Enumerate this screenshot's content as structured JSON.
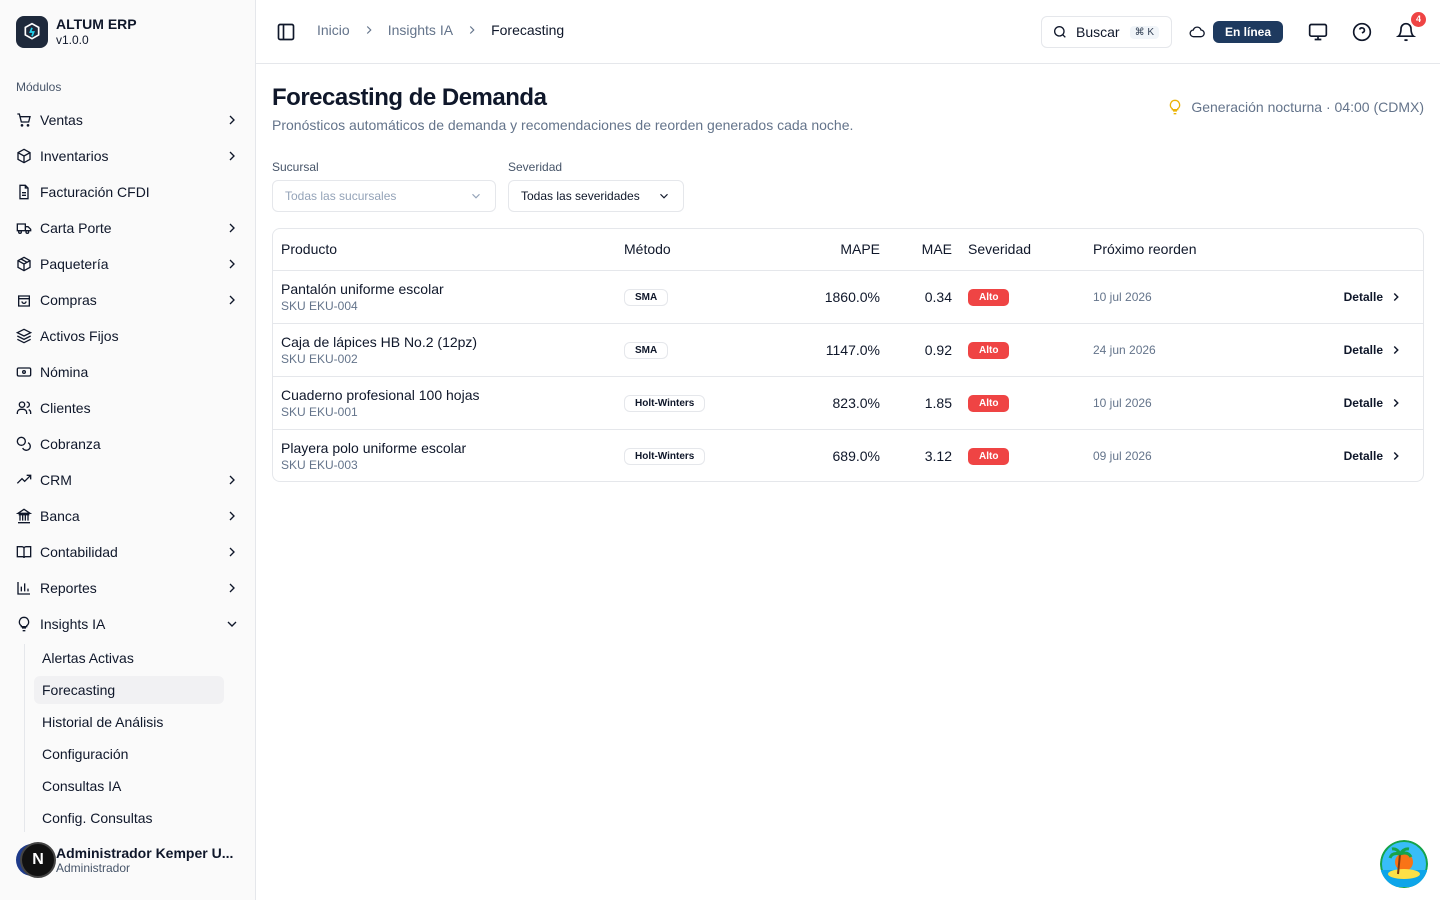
{
  "app": {
    "name": "ALTUM ERP",
    "version": "v1.0.0"
  },
  "sidebar": {
    "section_label": "Módulos",
    "items": [
      {
        "label": "Ventas",
        "icon": "cart-icon",
        "has_children": true
      },
      {
        "label": "Inventarios",
        "icon": "box-icon",
        "has_children": true
      },
      {
        "label": "Facturación CFDI",
        "icon": "file-text-icon",
        "has_children": false
      },
      {
        "label": "Carta Porte",
        "icon": "truck-icon",
        "has_children": true
      },
      {
        "label": "Paquetería",
        "icon": "package-icon",
        "has_children": true
      },
      {
        "label": "Compras",
        "icon": "shopping-bag-icon",
        "has_children": true
      },
      {
        "label": "Activos Fijos",
        "icon": "layers-icon",
        "has_children": false
      },
      {
        "label": "Nómina",
        "icon": "banknote-icon",
        "has_children": false
      },
      {
        "label": "Clientes",
        "icon": "users-icon",
        "has_children": false
      },
      {
        "label": "Cobranza",
        "icon": "coins-icon",
        "has_children": false
      },
      {
        "label": "CRM",
        "icon": "trending-up-icon",
        "has_children": true
      },
      {
        "label": "Banca",
        "icon": "landmark-icon",
        "has_children": true
      },
      {
        "label": "Contabilidad",
        "icon": "book-icon",
        "has_children": true
      },
      {
        "label": "Reportes",
        "icon": "bar-chart-icon",
        "has_children": true
      },
      {
        "label": "Insights IA",
        "icon": "lightbulb-icon",
        "has_children": true,
        "expanded": true
      }
    ],
    "sub_items": [
      {
        "label": "Alertas Activas",
        "active": false
      },
      {
        "label": "Forecasting",
        "active": true
      },
      {
        "label": "Historial de Análisis",
        "active": false
      },
      {
        "label": "Configuración",
        "active": false
      },
      {
        "label": "Consultas IA",
        "active": false
      },
      {
        "label": "Config. Consultas",
        "active": false
      }
    ],
    "user": {
      "name": "Administrador Kemper U...",
      "role": "Administrador",
      "initial": "N"
    }
  },
  "header": {
    "breadcrumb": [
      "Inicio",
      "Insights IA",
      "Forecasting"
    ],
    "search_label": "Buscar",
    "search_shortcut": "⌘ K",
    "status": "En línea",
    "notifications_count": "4"
  },
  "page": {
    "title": "Forecasting de Demanda",
    "subtitle": "Pronósticos automáticos de demanda y recomendaciones de reorden generados cada noche.",
    "schedule": "Generación nocturna · 04:00 (CDMX)"
  },
  "filters": {
    "branch": {
      "label": "Sucursal",
      "value": "Todas las sucursales"
    },
    "severity": {
      "label": "Severidad",
      "value": "Todas las severidades"
    }
  },
  "table": {
    "headers": [
      "Producto",
      "Método",
      "MAPE",
      "MAE",
      "Severidad",
      "Próximo reorden"
    ],
    "action_label": "Detalle",
    "rows": [
      {
        "name": "Pantalón uniforme escolar",
        "sku": "SKU EKU-004",
        "method": "SMA",
        "mape": "1860.0%",
        "mae": "0.34",
        "severity": "Alto",
        "reorder": "10 jul 2026"
      },
      {
        "name": "Caja de lápices HB No.2 (12pz)",
        "sku": "SKU EKU-002",
        "method": "SMA",
        "mape": "1147.0%",
        "mae": "0.92",
        "severity": "Alto",
        "reorder": "24 jun 2026"
      },
      {
        "name": "Cuaderno profesional 100 hojas",
        "sku": "SKU EKU-001",
        "method": "Holt-Winters",
        "mape": "823.0%",
        "mae": "1.85",
        "severity": "Alto",
        "reorder": "10 jul 2026"
      },
      {
        "name": "Playera polo uniforme escolar",
        "sku": "SKU EKU-003",
        "method": "Holt-Winters",
        "mape": "689.0%",
        "mae": "3.12",
        "severity": "Alto",
        "reorder": "09 jul 2026"
      }
    ]
  },
  "colors": {
    "accent": "#1e3a5f",
    "severity_high": "#ef4444",
    "schedule_icon": "#eab308"
  }
}
